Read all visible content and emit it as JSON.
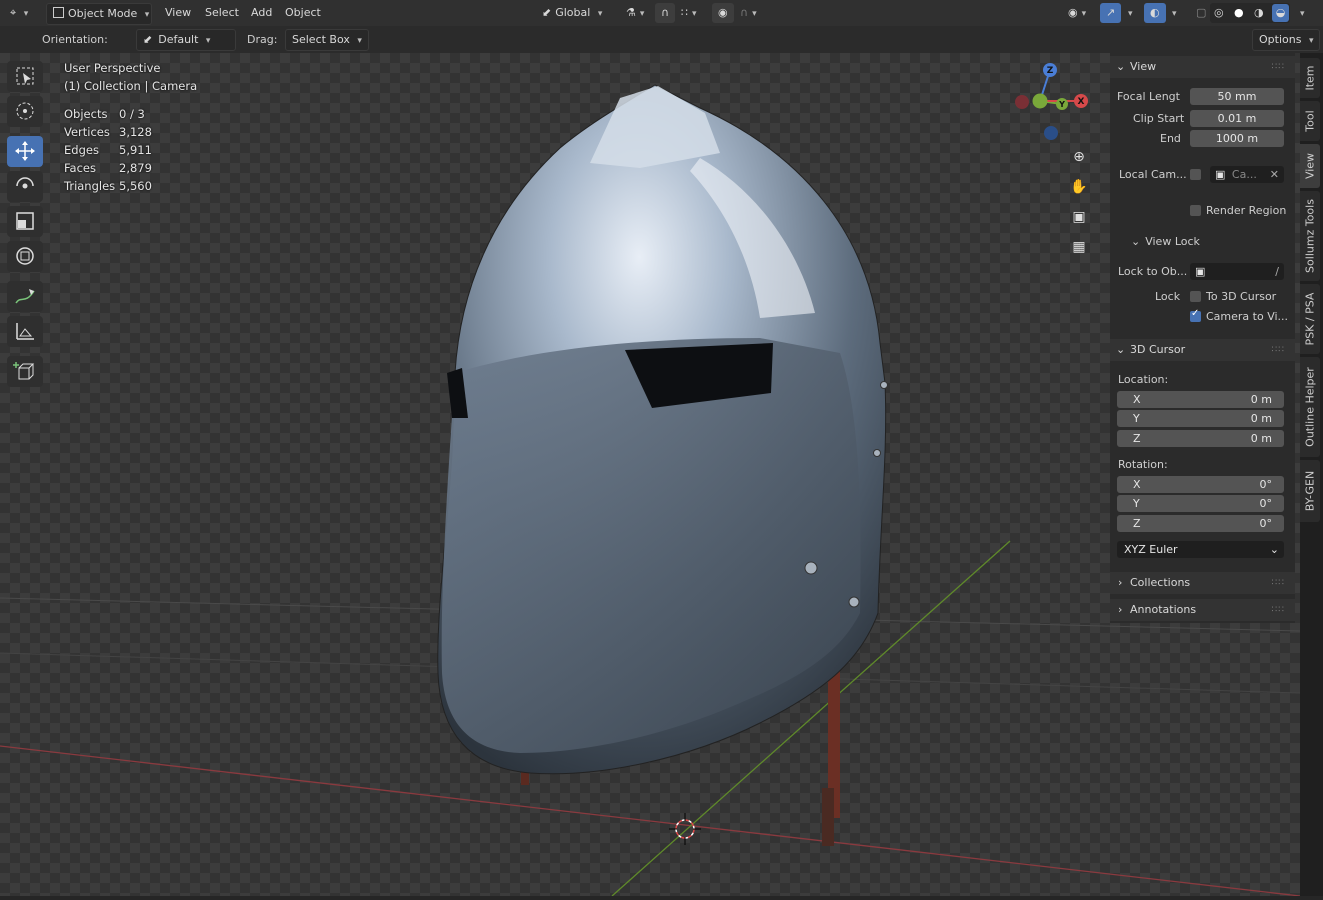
{
  "header": {
    "mode": "Object Mode",
    "menus": [
      "View",
      "Select",
      "Add",
      "Object"
    ],
    "transform_orientation": "Global"
  },
  "toolsettings": {
    "orientation_label": "Orientation:",
    "orientation_value": "Default",
    "drag_label": "Drag:",
    "drag_value": "Select Box",
    "options": "Options"
  },
  "overlay": {
    "perspective": "User Perspective",
    "collection": "(1) Collection | Camera",
    "stats": [
      {
        "label": "Objects",
        "value": "0 / 3"
      },
      {
        "label": "Vertices",
        "value": "3,128"
      },
      {
        "label": "Edges",
        "value": "5,911"
      },
      {
        "label": "Faces",
        "value": "2,879"
      },
      {
        "label": "Triangles",
        "value": "5,560"
      }
    ]
  },
  "gizmo": {
    "z": "Z",
    "y": "Y",
    "x": "X"
  },
  "npanel": {
    "view": {
      "title": "View",
      "focal_label": "Focal Lengt",
      "focal_value": "50 mm",
      "clip_start_label": "Clip Start",
      "clip_start_value": "0.01 m",
      "end_label": "End",
      "end_value": "1000 m",
      "local_cam_label": "Local Cam...",
      "local_cam_value": "Ca...",
      "render_region": "Render Region",
      "view_lock_title": "View Lock",
      "lock_to_obj_label": "Lock to Ob...",
      "lock_label": "Lock",
      "to_3d_cursor": "To 3D Cursor",
      "camera_to_view": "Camera to Vi...",
      "camera_to_view_checked": true
    },
    "cursor": {
      "title": "3D Cursor",
      "location_label": "Location:",
      "location": [
        {
          "axis": "X",
          "value": "0 m"
        },
        {
          "axis": "Y",
          "value": "0 m"
        },
        {
          "axis": "Z",
          "value": "0 m"
        }
      ],
      "rotation_label": "Rotation:",
      "rotation": [
        {
          "axis": "X",
          "value": "0°"
        },
        {
          "axis": "Y",
          "value": "0°"
        },
        {
          "axis": "Z",
          "value": "0°"
        }
      ],
      "rotation_mode": "XYZ Euler"
    },
    "collections": "Collections",
    "annotations": "Annotations"
  },
  "tabs": [
    "Item",
    "Tool",
    "View",
    "Sollumz Tools",
    "PSK / PSA",
    "Outline Helper",
    "BY-GEN"
  ],
  "active_tab": "View"
}
